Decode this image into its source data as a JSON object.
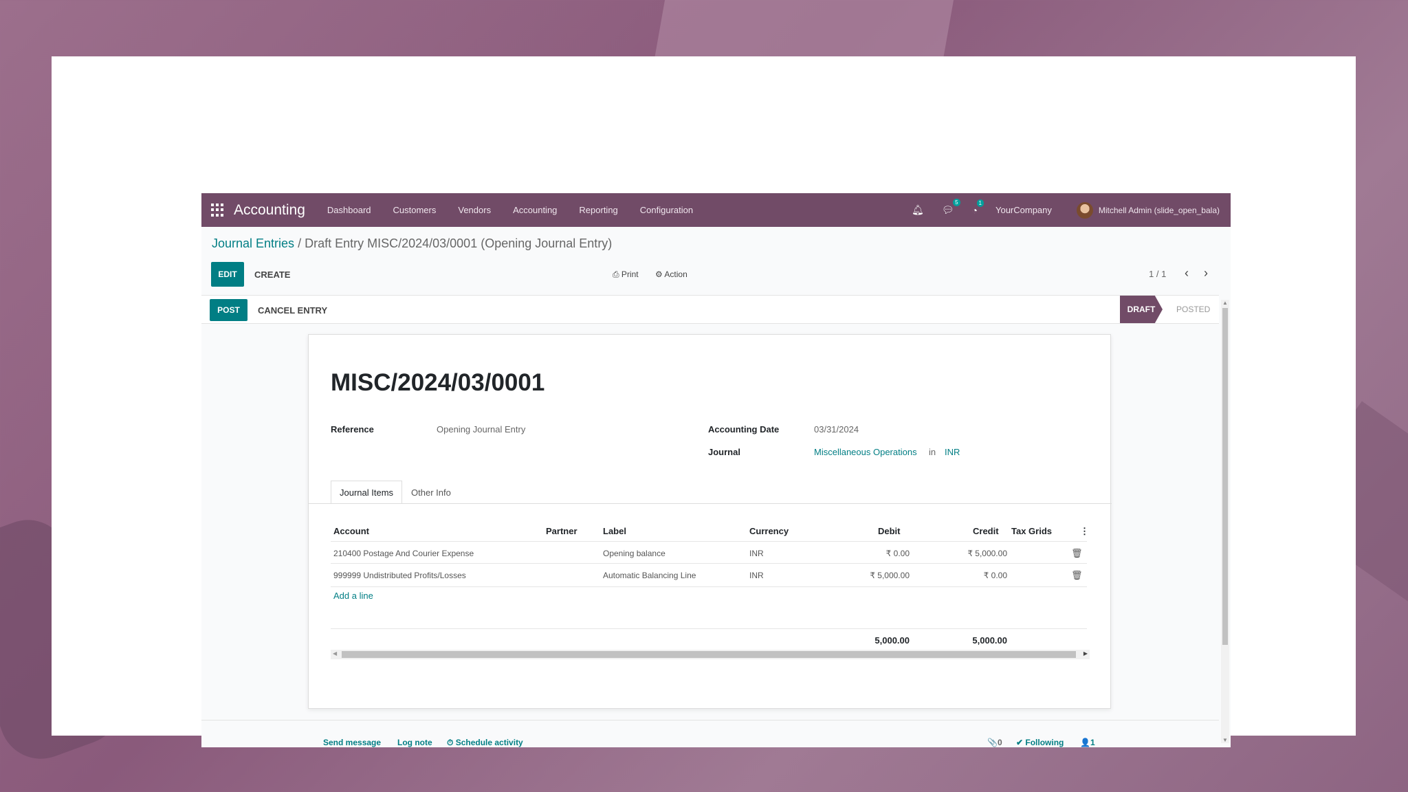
{
  "navbar": {
    "brand": "Accounting",
    "menu": [
      "Dashboard",
      "Customers",
      "Vendors",
      "Accounting",
      "Reporting",
      "Configuration"
    ],
    "messages_badge": "5",
    "activities_badge": "1",
    "company": "YourCompany",
    "user": "Mitchell Admin (slide_open_bala)"
  },
  "breadcrumb": {
    "parent": "Journal Entries",
    "separator": " / ",
    "current": "Draft Entry MISC/2024/03/0001 (Opening Journal Entry)"
  },
  "control": {
    "edit_label": "EDIT",
    "create_label": "CREATE",
    "print_label": "⎙ Print",
    "action_label": "⚙ Action",
    "pager": "1 / 1",
    "prev": "‹",
    "next": "›"
  },
  "statusbar": {
    "post_label": "POST",
    "cancel_label": "CANCEL ENTRY",
    "stages": [
      "DRAFT",
      "POSTED"
    ],
    "active_stage": "DRAFT"
  },
  "form": {
    "name": "MISC/2024/03/0001",
    "reference_label": "Reference",
    "reference_value": "Opening Journal Entry",
    "date_label": "Accounting Date",
    "date_value": "03/31/2024",
    "journal_label": "Journal",
    "journal_value": "Miscellaneous Operations",
    "journal_in": "in",
    "currency": "INR"
  },
  "tabs": [
    "Journal Items",
    "Other Info"
  ],
  "table": {
    "headers": [
      "Account",
      "Partner",
      "Label",
      "Currency",
      "Debit",
      "Credit",
      "Tax Grids"
    ],
    "rows": [
      {
        "account": "210400 Postage And Courier Expense",
        "partner": "",
        "label": "Opening balance",
        "currency": "INR",
        "debit": "₹ 0.00",
        "credit": "₹ 5,000.00"
      },
      {
        "account": "999999 Undistributed Profits/Losses",
        "partner": "",
        "label": "Automatic Balancing Line",
        "currency": "INR",
        "debit": "₹ 5,000.00",
        "credit": "₹ 0.00"
      }
    ],
    "add_line": "Add a line",
    "total_debit": "5,000.00",
    "total_credit": "5,000.00"
  },
  "chatter": {
    "send_message": "Send message",
    "log_note": "Log note",
    "schedule_activity": "⏱ Schedule activity",
    "attachments": "📎0",
    "following": "✔ Following",
    "followers": "👤1"
  }
}
